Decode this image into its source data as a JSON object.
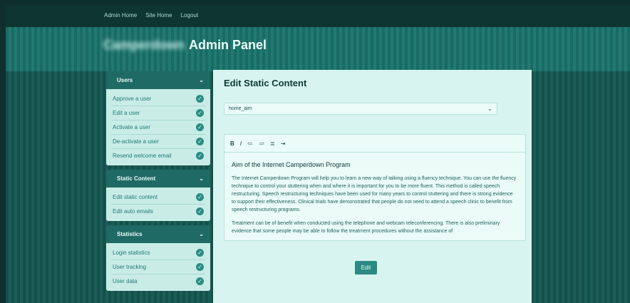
{
  "top_nav": [
    "Admin Home",
    "Site Home",
    "Logout"
  ],
  "site_name": "Camperdown",
  "panel_title": "Admin Panel",
  "sidebar": {
    "sections": [
      {
        "title": "Users",
        "items": [
          "Approve a user",
          "Edit a user",
          "Activate a user",
          "De-activate a user",
          "Resend welcome email"
        ]
      },
      {
        "title": "Static Content",
        "items": [
          "Edit static content",
          "Edit auto emails"
        ]
      },
      {
        "title": "Statistics",
        "items": [
          "Login statistics",
          "User tracking",
          "User data"
        ]
      }
    ]
  },
  "main": {
    "title": "Edit Static Content",
    "selected_page": "home_aim",
    "toolbar": [
      "B",
      "I",
      "≔",
      "≕",
      "≣",
      "⇥"
    ],
    "content_heading": "Aim of the Internet Camperdown Program",
    "paragraphs": [
      "The Internet Camperdown Program will help you to learn a new way of talking using a fluency technique. You can use the fluency technique to control your stuttering when and where it is important for you to be more fluent. This method is called speech restructuring. Speech restructuring techniques have been used for many years to control stuttering and there is strong evidence to support their effectiveness. Clinical trials have demonstrated that people do not need to attend a speech clinic to benefit from speech restructuring programs.",
      "Treatment can be of benefit when conducted using the telephone and webcam teleconferencing. There is also preliminary evidence that some people may be able to follow the treatment procedures without the assistance of"
    ],
    "edit_button": "Edit"
  },
  "colors": {
    "accent": "#2b8b83",
    "background": "#15504b"
  }
}
